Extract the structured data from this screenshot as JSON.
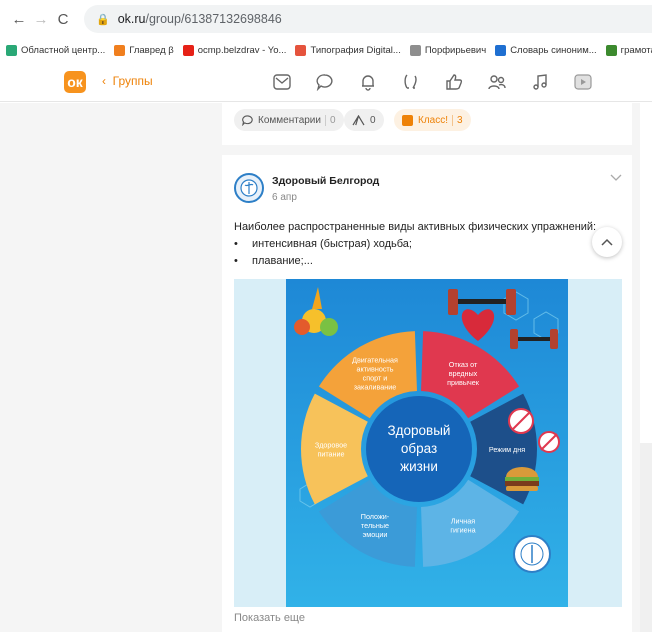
{
  "browser": {
    "url_domain": "ok.ru",
    "url_path": "/group/61387132698846",
    "nav": {
      "back": "←",
      "forward": "→",
      "reload": "C"
    },
    "bookmarks": [
      {
        "label": "Областной центр...",
        "color": "#2aa876"
      },
      {
        "label": "Главред β",
        "color": "#f07f1e"
      },
      {
        "label": "ocmp.belzdrav - Yo...",
        "color": "#e62117"
      },
      {
        "label": "Типография Digital...",
        "color": "#e5533d"
      },
      {
        "label": "Порфирьевич",
        "color": "#8e8e8e"
      },
      {
        "label": "Словарь синоним...",
        "color": "#1f6fd1"
      },
      {
        "label": "грамота",
        "color": "#3c8a2e"
      }
    ]
  },
  "header": {
    "logo": "ок",
    "back_label": "Группы",
    "icons": [
      "mail-icon",
      "chat-icon",
      "bell-icon",
      "guests-icon",
      "like-icon",
      "friends-icon",
      "music-icon",
      "video-icon"
    ]
  },
  "prev_post": {
    "comments_label": "Комментарии",
    "comments_count": "0",
    "shares_count": "0",
    "klass_label": "Класс!",
    "klass_count": "3"
  },
  "post": {
    "group_name": "Здоровый Белгород",
    "date": "6 апр",
    "intro": "Наиболее распространенные виды активных физических упражнений:",
    "bullets": [
      "интенсивная (быстрая) ходьба;",
      "плавание;..."
    ],
    "show_more": "Показать еще"
  },
  "infographic": {
    "center": [
      "Здоровый",
      "образ",
      "жизни"
    ],
    "segments": [
      {
        "label": [
          "Двигательная",
          "активность",
          "спорт и",
          "закаливание"
        ],
        "color": "#f4a23a"
      },
      {
        "label": [
          "Отказ от",
          "вредных",
          "привычек"
        ],
        "color": "#e0384f"
      },
      {
        "label": [
          "Режим дня"
        ],
        "color": "#1d4f8a"
      },
      {
        "label": [
          "Личная",
          "гигиена"
        ],
        "color": "#5db4e6"
      },
      {
        "label": [
          "Положи-",
          "тельные",
          "эмоции"
        ],
        "color": "#3b9bd8"
      },
      {
        "label": [
          "Здоровое",
          "питание"
        ],
        "color": "#f7c25a"
      }
    ]
  }
}
